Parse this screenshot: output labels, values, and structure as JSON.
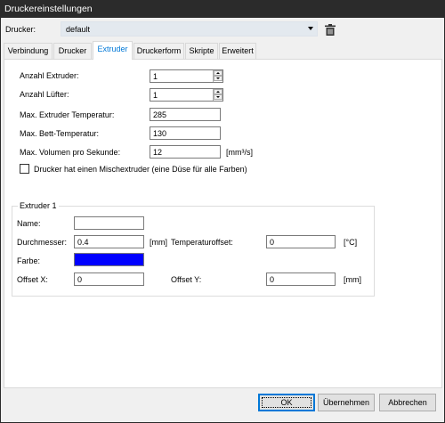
{
  "window": {
    "title": "Druckereinstellungen"
  },
  "printer": {
    "label": "Drucker:",
    "value": "default"
  },
  "tabs": [
    {
      "label": "Verbindung"
    },
    {
      "label": "Drucker"
    },
    {
      "label": "Extruder"
    },
    {
      "label": "Druckerform"
    },
    {
      "label": "Skripte"
    },
    {
      "label": "Erweitert"
    }
  ],
  "extruder_settings": {
    "num_extruders_label": "Anzahl Extruder:",
    "num_extruders_value": "1",
    "num_fans_label": "Anzahl Lüfter:",
    "num_fans_value": "1",
    "max_extruder_temp_label": "Max. Extruder Temperatur:",
    "max_extruder_temp_value": "285",
    "max_bed_temp_label": "Max. Bett-Temperatur:",
    "max_bed_temp_value": "130",
    "max_volume_label": "Max. Volumen pro Sekunde:",
    "max_volume_value": "12",
    "max_volume_unit": "[mm³/s]",
    "mixing_extruder_label": "Drucker hat einen Mischextruder (eine Düse für alle Farben)",
    "mixing_extruder_checked": false
  },
  "extruder1": {
    "group_title": "Extruder 1",
    "name_label": "Name:",
    "name_value": "",
    "diameter_label": "Durchmesser:",
    "diameter_value": "0.4",
    "diameter_unit": "[mm]",
    "temp_offset_label": "Temperaturoffset:",
    "temp_offset_value": "0",
    "temp_offset_unit": "[°C]",
    "color_label": "Farbe:",
    "color_value": "#0000ff",
    "offset_x_label": "Offset X:",
    "offset_x_value": "0",
    "offset_y_label": "Offset Y:",
    "offset_y_value": "0",
    "offset_y_unit": "[mm]"
  },
  "buttons": {
    "ok": "OK",
    "apply": "Übernehmen",
    "cancel": "Abbrechen"
  }
}
